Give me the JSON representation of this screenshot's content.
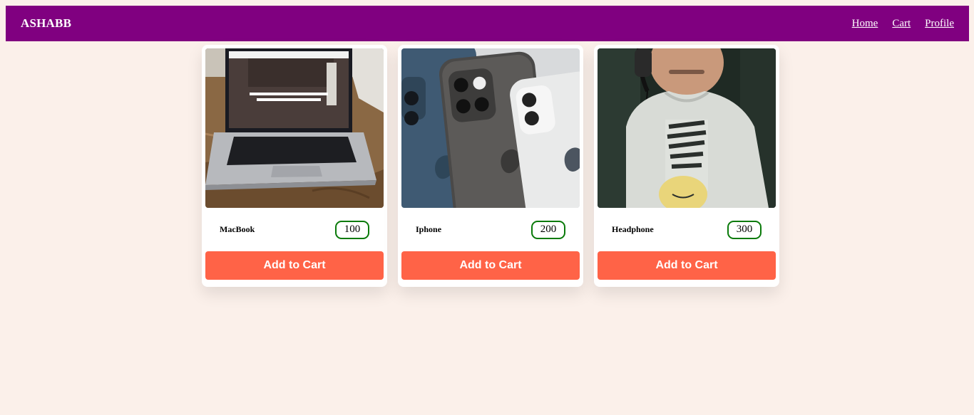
{
  "header": {
    "brand": "ASHABB",
    "nav": [
      {
        "label": "Home"
      },
      {
        "label": "Cart"
      },
      {
        "label": "Profile"
      }
    ],
    "background_color": "#800080"
  },
  "products": [
    {
      "name": "MacBook",
      "price": "100",
      "button_label": "Add to Cart",
      "image": "macbook-laptop-photo"
    },
    {
      "name": "Iphone",
      "price": "200",
      "button_label": "Add to Cart",
      "image": "iphone-group-photo"
    },
    {
      "name": "Headphone",
      "price": "300",
      "button_label": "Add to Cart",
      "image": "child-with-headphones-photo"
    }
  ],
  "colors": {
    "page_background": "#fbf0ea",
    "button": "#ff6347",
    "price_border": "#0a7a0a"
  }
}
